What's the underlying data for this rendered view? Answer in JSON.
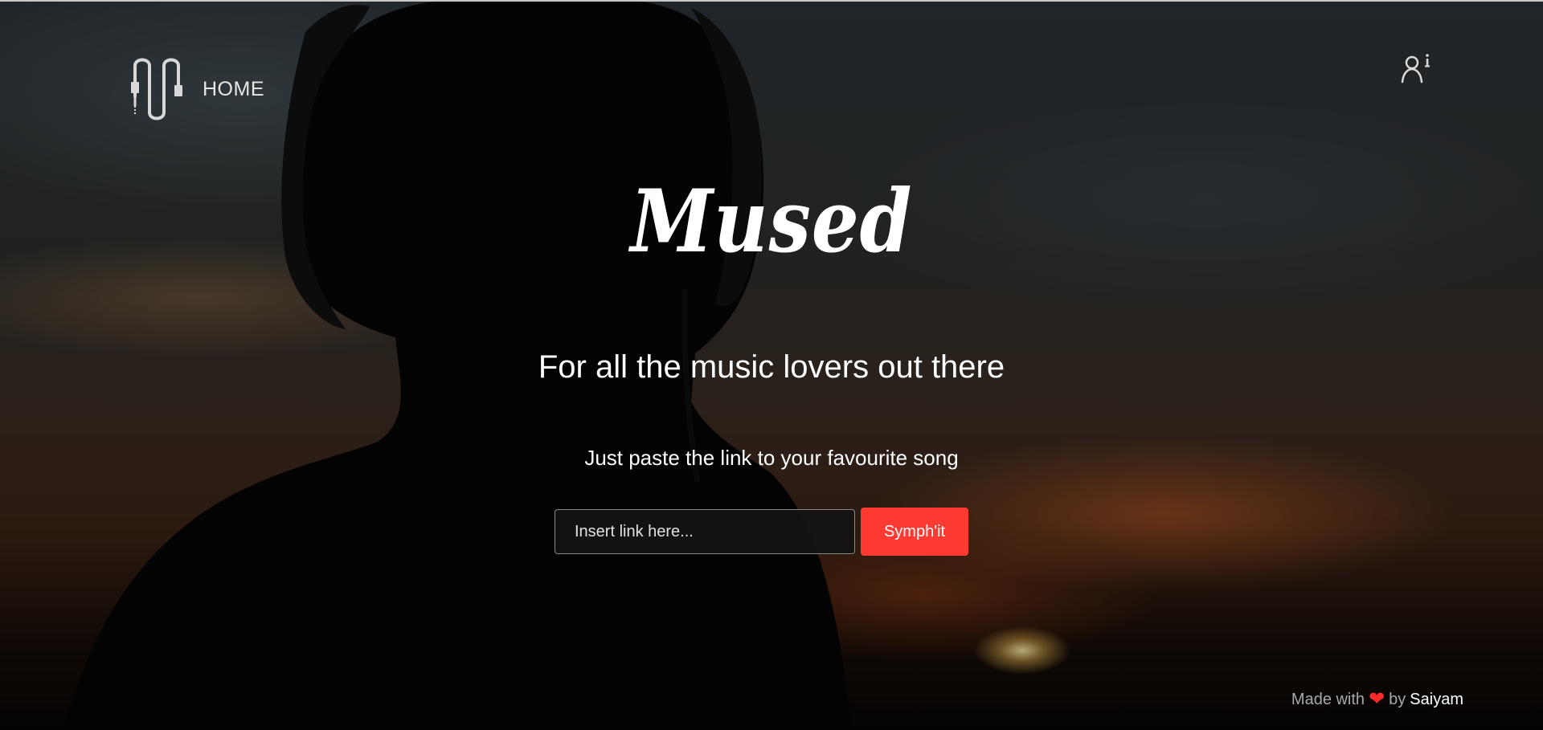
{
  "nav": {
    "home_label": "HOME",
    "logo_icon": "audio-cable-icon",
    "about_icon": "user-info-icon"
  },
  "hero": {
    "title": "Mused",
    "tagline": "For all the music lovers out there",
    "subtitle": "Just paste the link to your favourite song"
  },
  "form": {
    "input_placeholder": "Insert link here...",
    "input_value": "",
    "submit_label": "Symph'it"
  },
  "footer": {
    "prefix": "Made with",
    "heart_icon": "heart-icon",
    "by": "by",
    "author": "Saiyam"
  },
  "colors": {
    "accent": "#ff3a32",
    "heart": "#ff2a2a",
    "text": "#ffffff"
  }
}
